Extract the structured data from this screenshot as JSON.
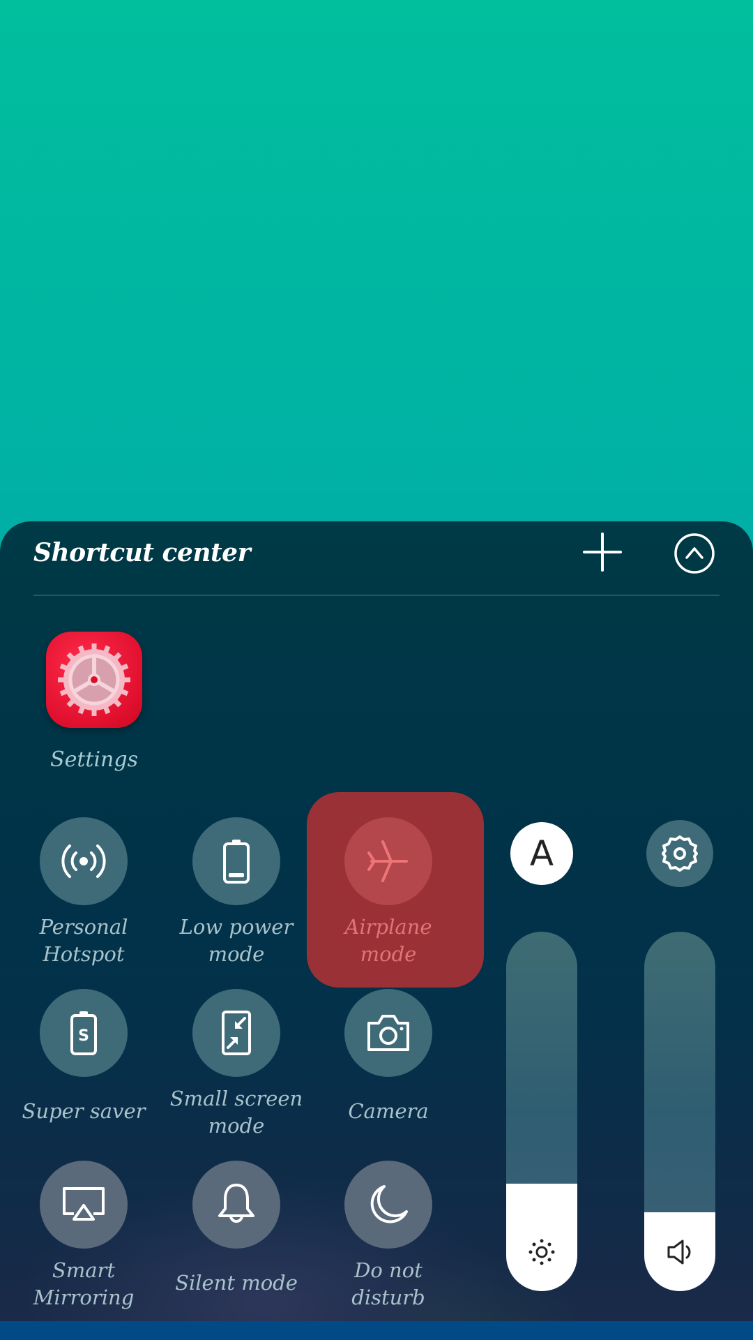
{
  "panel": {
    "title": "Shortcut center",
    "add_button_icon": "plus-icon",
    "collapse_button_icon": "chevron-up-circle-icon"
  },
  "apps": [
    {
      "label": "Settings",
      "icon": "settings-gear-icon",
      "color": "#e8132f"
    }
  ],
  "shortcuts": [
    {
      "label_line1": "Personal",
      "label_line2": "Hotspot",
      "icon": "hotspot-icon",
      "active": false
    },
    {
      "label_line1": "Low power",
      "label_line2": "mode",
      "icon": "battery-low-icon",
      "active": false
    },
    {
      "label_line1": "Airplane",
      "label_line2": "mode",
      "icon": "airplane-icon",
      "active": true
    },
    {
      "label_line1": "Super saver",
      "label_line2": "",
      "icon": "super-saver-battery-icon",
      "active": false
    },
    {
      "label_line1": "Small screen",
      "label_line2": "mode",
      "icon": "small-screen-icon",
      "active": false
    },
    {
      "label_line1": "Camera",
      "label_line2": "",
      "icon": "camera-icon",
      "active": false
    },
    {
      "label_line1": "Smart",
      "label_line2": "Mirroring",
      "icon": "screen-mirroring-icon",
      "active": false
    },
    {
      "label_line1": "Silent mode",
      "label_line2": "",
      "icon": "bell-icon",
      "active": false
    },
    {
      "label_line1": "Do not",
      "label_line2": "disturb",
      "icon": "moon-icon",
      "active": false
    }
  ],
  "sliders": {
    "auto_brightness_label": "A",
    "brightness": {
      "icon": "sun-icon",
      "value_percent": 30
    },
    "volume": {
      "icon": "speaker-icon",
      "value_percent": 22
    },
    "settings_icon": "gear-icon"
  },
  "colors": {
    "active_highlight": "#9a3136",
    "active_text": "#e07577",
    "tile_circle": "#3f6b79"
  }
}
